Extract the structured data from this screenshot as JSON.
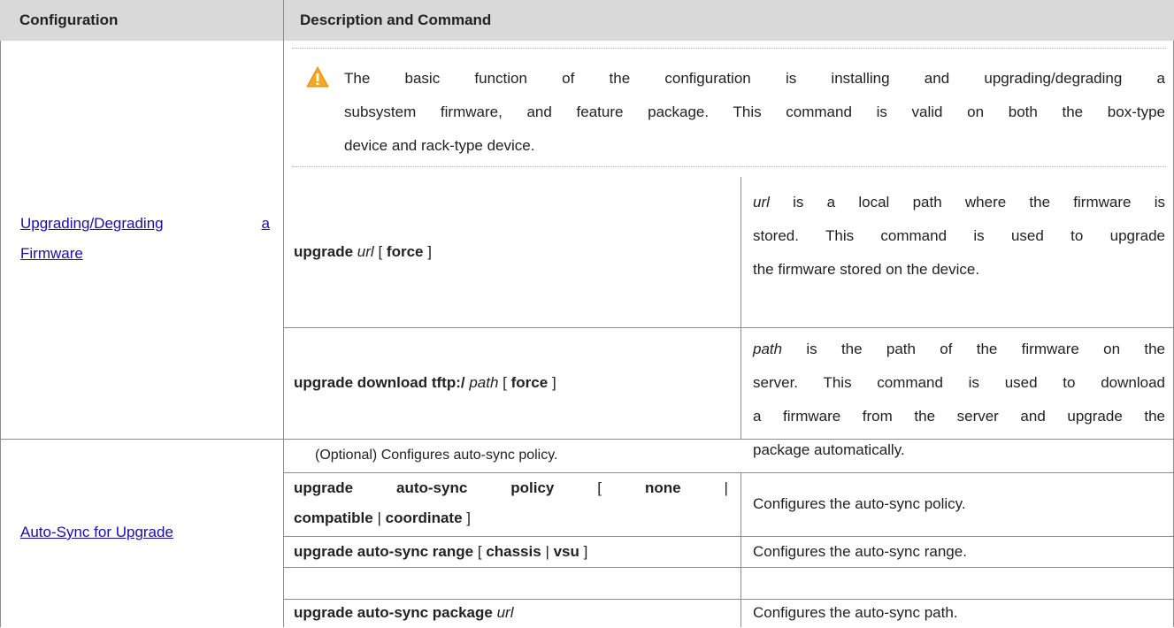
{
  "header": {
    "col1": "Configuration",
    "col2": "Description and Command"
  },
  "section1": {
    "link_line1": "Upgrading/Degrading",
    "link_line1_end": "a",
    "link_line2": "Firmware",
    "note_lines": [
      "The basic function of the configuration is installing and upgrading/degrading a",
      "subsystem firmware, and feature package. This command is valid on both the box-type",
      "device and rack-type device."
    ],
    "warning_icon": "warning-triangle-icon",
    "cmd1": {
      "kw": "upgrade",
      "arg": "url",
      "open": "[",
      "opt": "force",
      "close": "]",
      "desc_arg": "url",
      "desc_line1_rest": "is a local path where the firmware is",
      "desc_line2": "stored. This command is used to upgrade",
      "desc_line3": "the firmware stored on the device."
    },
    "cmd2": {
      "kw": "upgrade download tftp:/",
      "arg": "path",
      "open": "[",
      "opt": "force",
      "close": "]",
      "desc_arg": "path",
      "desc_line1_rest": "is the path of the firmware on the",
      "desc_line2": "server. This command is used to download",
      "desc_line3": "a firmware from the server and upgrade the",
      "desc_line4": "package automatically."
    }
  },
  "section2": {
    "link": "Auto-Sync for Upgrade",
    "intro": "(Optional) Configures auto-sync policy.",
    "cmd1": {
      "kw1": "upgrade",
      "kw2": "auto-sync",
      "kw3": "policy",
      "open": "[",
      "opt1": "none",
      "sep": "|",
      "opt2": "compatible",
      "opt3": "coordinate",
      "close": "]",
      "desc": "Configures the auto-sync policy."
    },
    "cmd2": {
      "kw": "upgrade auto-sync range",
      "open": "[",
      "opt1": "chassis",
      "sep": "|",
      "opt2": "vsu",
      "close": "]",
      "desc": "Configures the auto-sync range."
    },
    "cmd3": {
      "kw": "upgrade auto-sync package",
      "arg": "url",
      "desc": "Configures the auto-sync path."
    }
  },
  "colors": {
    "header_bg": "#d9d9d9",
    "border": "#8c8c8c",
    "link": "#1a0dab",
    "warning": "#f5a623"
  }
}
